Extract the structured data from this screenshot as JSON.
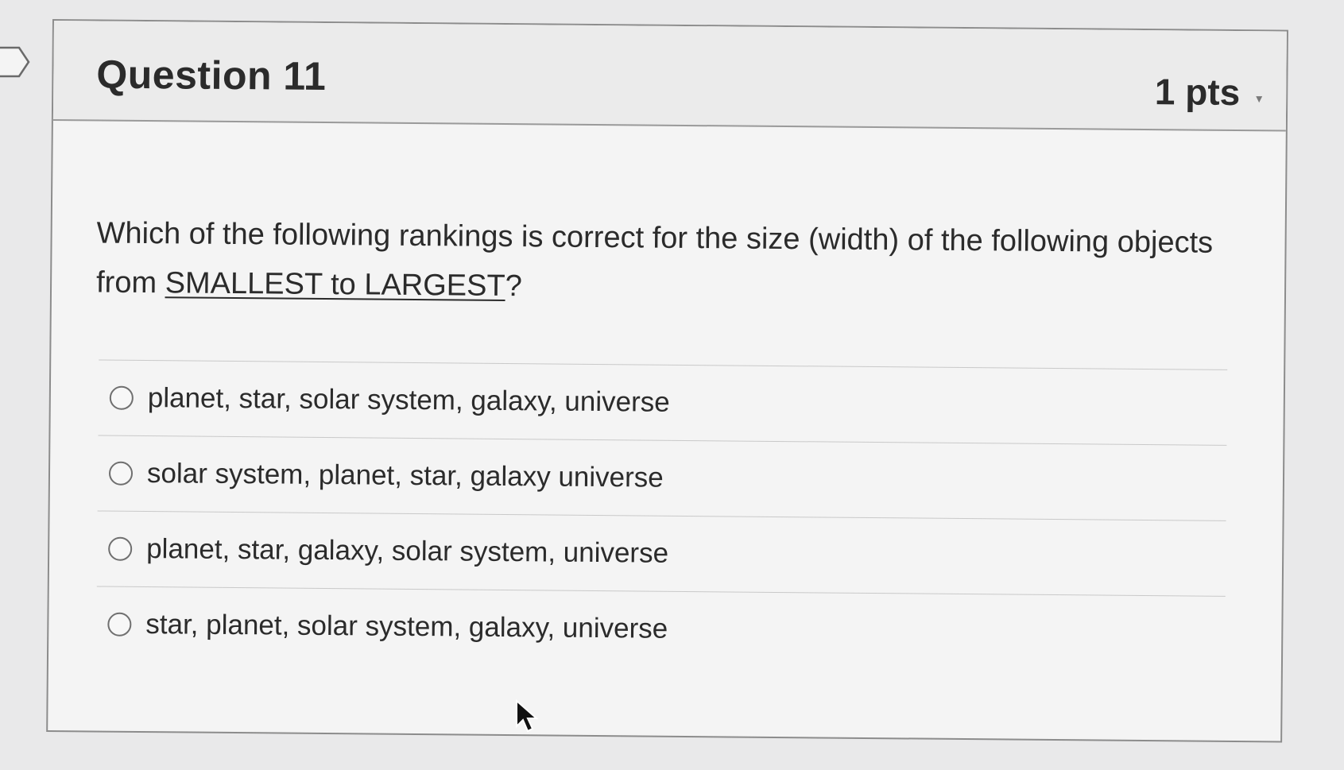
{
  "question": {
    "title": "Question 11",
    "points": "1 pts",
    "text_before": "Which of the following rankings is correct for the size (width) of the following objects from ",
    "text_emphasis": "SMALLEST to LARGEST",
    "text_after": "?"
  },
  "answers": [
    {
      "label": "planet, star, solar system, galaxy, universe"
    },
    {
      "label": "solar system, planet, star, galaxy universe"
    },
    {
      "label": "planet, star, galaxy, solar system, universe"
    },
    {
      "label": "star, planet, solar system, galaxy, universe"
    }
  ],
  "icons": {
    "flag": "flag-marker-icon",
    "points_menu": "small-triangle-icon",
    "radio": "radio-circle-icon",
    "cursor": "mouse-pointer-icon"
  }
}
